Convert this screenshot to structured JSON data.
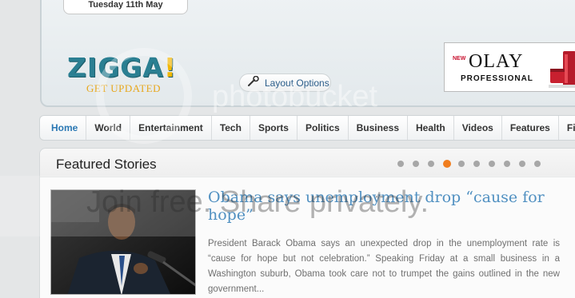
{
  "header": {
    "date": "Tuesday 11th May",
    "logo_main": "ZIGGA",
    "logo_bang": "!",
    "logo_tagline": "GET UPDATED",
    "layout_options_label": "Layout Options"
  },
  "ad": {
    "badge": "NEW",
    "brand": "OLAY",
    "subtitle": "PROFESSIONAL"
  },
  "nav": {
    "items": [
      {
        "label": "Home",
        "active": true
      },
      {
        "label": "World"
      },
      {
        "label": "Entertainment"
      },
      {
        "label": "Tech"
      },
      {
        "label": "Sports"
      },
      {
        "label": "Politics"
      },
      {
        "label": "Business"
      },
      {
        "label": "Health"
      },
      {
        "label": "Videos"
      },
      {
        "label": "Features"
      },
      {
        "label": "Fina"
      }
    ]
  },
  "featured": {
    "title": "Featured Stories",
    "slider": {
      "count": 10,
      "active_index": 3
    },
    "story": {
      "headline": "Obama says unemployment drop “cause for hope”",
      "summary": "President Barack Obama says an unexpected drop in the unemployment rate is “cause for hope but not celebration.” Speaking Friday at a small business in a Washington suburb, Obama took care not to trumpet the gains outlined in the new government..."
    }
  },
  "watermark": {
    "logo": "photobucket",
    "tagline": "Join free. Share privately."
  },
  "colors": {
    "accent_blue": "#2a78b4",
    "logo_teal": "#2b7f92",
    "logo_yellow": "#f2b705",
    "slider_active": "#f07d1e"
  }
}
